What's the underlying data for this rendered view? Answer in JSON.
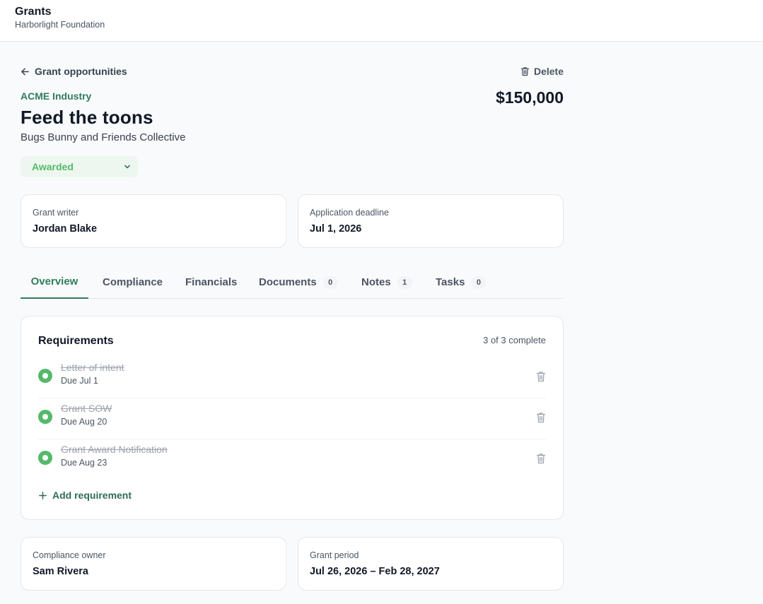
{
  "app": {
    "title": "Grants",
    "organization": "Harborlight Foundation"
  },
  "nav": {
    "back_label": "Grant opportunities"
  },
  "actions": {
    "delete_label": "Delete"
  },
  "grant": {
    "funder": "ACME Industry",
    "title": "Feed the toons",
    "grantee": "Bugs Bunny and Friends Collective",
    "amount": "$150,000",
    "status": "Awarded"
  },
  "details": {
    "writer_label": "Grant writer",
    "writer_value": "Jordan Blake",
    "deadline_label": "Application deadline",
    "deadline_value": "Jul 1, 2026",
    "owner_label": "Compliance owner",
    "owner_value": "Sam Rivera",
    "period_label": "Grant period",
    "period_value": "Jul 26, 2026 – Feb 28, 2027"
  },
  "tabs": [
    {
      "label": "Overview",
      "count": null,
      "active": true
    },
    {
      "label": "Compliance",
      "count": null
    },
    {
      "label": "Financials",
      "count": null
    },
    {
      "label": "Documents",
      "count": "0"
    },
    {
      "label": "Notes",
      "count": "1"
    },
    {
      "label": "Tasks",
      "count": "0"
    }
  ],
  "requirements": {
    "title": "Requirements",
    "summary": "3 of 3 complete",
    "add_label": "Add requirement",
    "items": [
      {
        "name": "Letter of intent",
        "due": "Due Jul 1",
        "complete": true
      },
      {
        "name": "Grant SOW",
        "due": "Due Aug 20",
        "complete": true
      },
      {
        "name": "Grant Award Notification",
        "due": "Due Aug 23",
        "complete": true
      }
    ]
  },
  "colors": {
    "accent": "#2f7d5c",
    "success": "#55b96a",
    "status_bg": "#edf7ef"
  },
  "icons": {
    "back": "arrow-left-icon",
    "delete": "trash-icon",
    "status": "chevron-down-icon",
    "check": "check-circle-icon",
    "add": "plus-icon"
  }
}
